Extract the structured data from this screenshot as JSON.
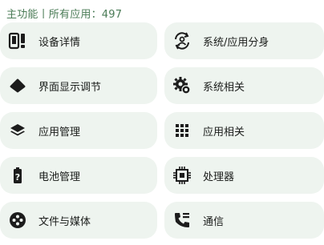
{
  "header": {
    "text": "主功能丨所有应用：497"
  },
  "left_items": [
    {
      "label": "设备详情",
      "icon": "device-info-icon"
    },
    {
      "label": "界面显示调节",
      "icon": "display-icon"
    },
    {
      "label": "应用管理",
      "icon": "layers-icon"
    },
    {
      "label": "电池管理",
      "icon": "battery-icon"
    },
    {
      "label": "文件与媒体",
      "icon": "media-icon"
    }
  ],
  "right_items": [
    {
      "label": "系统/应用分身",
      "icon": "user-switch-icon"
    },
    {
      "label": "系统相关",
      "icon": "settings-gear-icon"
    },
    {
      "label": "应用相关",
      "icon": "app-grid-icon"
    },
    {
      "label": "处理器",
      "icon": "cpu-chip-icon"
    },
    {
      "label": "通信",
      "icon": "phone-call-icon"
    }
  ],
  "colors": {
    "header": "#4b7c57",
    "card_bg": "#eef4ef",
    "icon": "#1c1c1c"
  }
}
